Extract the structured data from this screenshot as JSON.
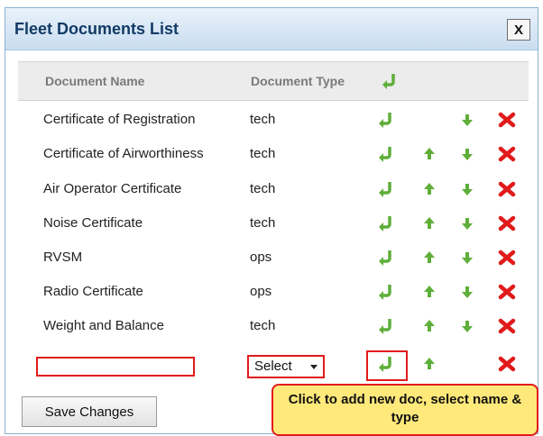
{
  "dialog": {
    "title": "Fleet Documents List",
    "close_label": "X"
  },
  "table": {
    "headers": [
      "Document Name",
      "Document Type"
    ],
    "rows": [
      {
        "name": "Certificate of Registration",
        "type": "tech",
        "up": false,
        "down": true
      },
      {
        "name": "Certificate of Airworthiness",
        "type": "tech",
        "up": true,
        "down": true
      },
      {
        "name": "Air Operator Certificate",
        "type": "tech",
        "up": true,
        "down": true
      },
      {
        "name": "Noise Certificate",
        "type": "tech",
        "up": true,
        "down": true
      },
      {
        "name": "RVSM",
        "type": "ops",
        "up": true,
        "down": true
      },
      {
        "name": "Radio Certificate",
        "type": "ops",
        "up": true,
        "down": true
      },
      {
        "name": "Weight and Balance",
        "type": "tech",
        "up": true,
        "down": true
      }
    ],
    "new_row": {
      "name_value": "",
      "type_select_value": "Select"
    }
  },
  "footer": {
    "save_label": "Save Changes",
    "tooltip": "Click to add new doc, select name & type"
  },
  "icons": {
    "insert": "insert-row-icon",
    "up": "move-up-icon",
    "down": "move-down-icon",
    "delete": "delete-icon"
  },
  "colors": {
    "title_text": "#123a66",
    "arrow_green": "#5fae3a",
    "delete_red": "#e11b1b",
    "highlight_red": "#e11b1b",
    "tooltip_bg": "#ffe97a"
  }
}
